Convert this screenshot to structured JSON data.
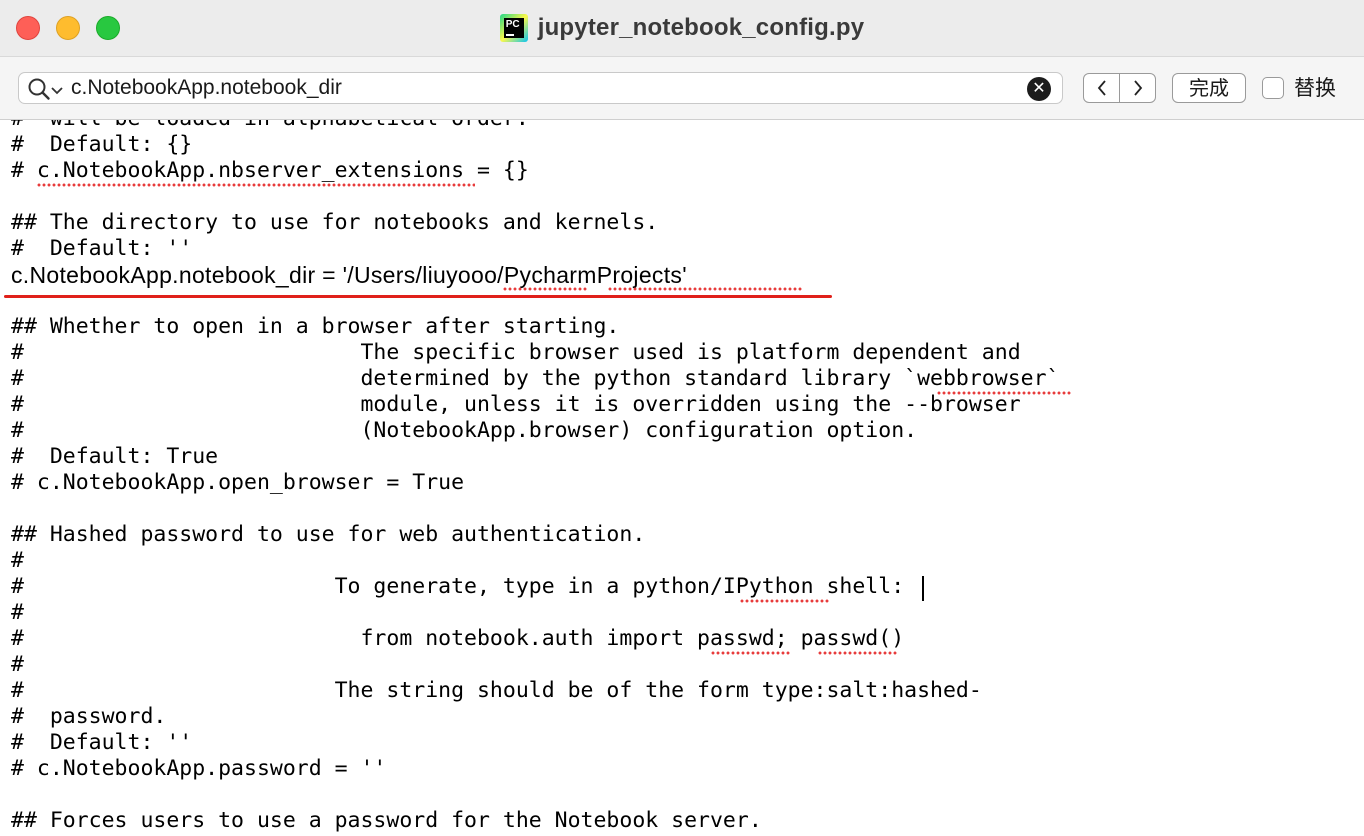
{
  "window": {
    "title": "jupyter_notebook_config.py",
    "app_icon": "pycharm-icon",
    "app_icon_text": "PC"
  },
  "find_bar": {
    "search_value": "c.NotebookApp.notebook_dir",
    "search_icon": "search-icon",
    "clear_label": "✕",
    "prev_icon": "chevron-left-icon",
    "next_icon": "chevron-right-icon",
    "done_label": "完成",
    "replace_label": "替换",
    "replace_checked": false
  },
  "editor": {
    "lines": [
      "#  will be loaded in alphabetical order.",
      "#  Default: {}",
      "# c.NotebookApp.nbserver_extensions = {}",
      "",
      "## The directory to use for notebooks and kernels.",
      "#  Default: ''",
      "c.NotebookApp.notebook_dir = '/Users/liuyooo/PycharmProjects'",
      "",
      "## Whether to open in a browser after starting.",
      "#                          The specific browser used is platform dependent and",
      "#                          determined by the python standard library `webbrowser`",
      "#                          module, unless it is overridden using the --browser",
      "#                          (NotebookApp.browser) configuration option.",
      "#  Default: True",
      "# c.NotebookApp.open_browser = True",
      "",
      "## Hashed password to use for web authentication.",
      "#",
      "#                        To generate, type in a python/IPython shell:",
      "#",
      "#                          from notebook.auth import passwd; passwd()",
      "#",
      "#                        The string should be of the form type:salt:hashed-",
      "#  password.",
      "#  Default: ''",
      "# c.NotebookApp.password = ''",
      "",
      "## Forces users to use a password for the Notebook server."
    ],
    "highlighted_line_index": 6,
    "highlight_color": "#e0201a",
    "spellcheck_color": "#e83b3b"
  }
}
